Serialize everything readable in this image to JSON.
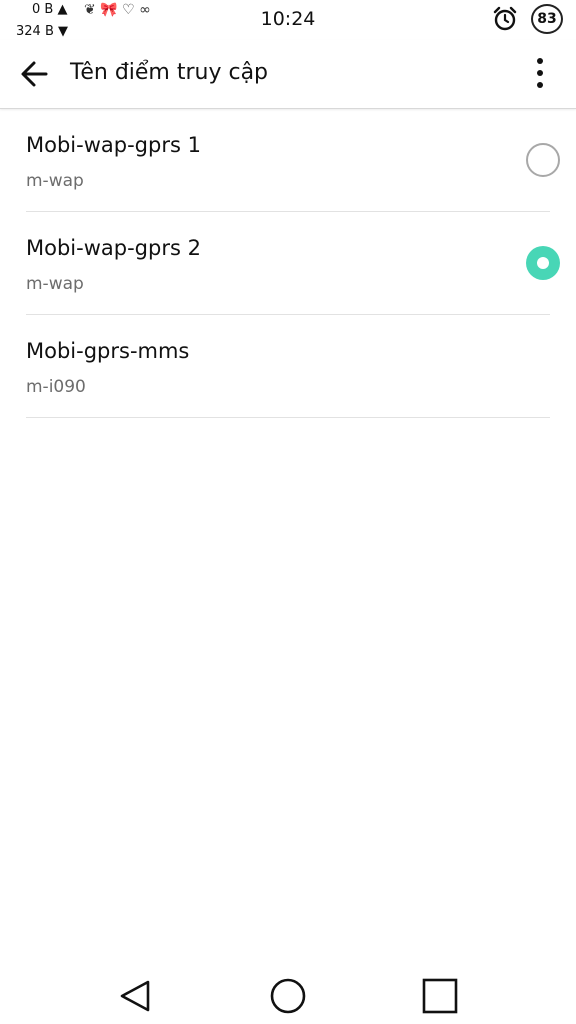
{
  "status_bar": {
    "net_up": "0 B ▲",
    "net_down": "324 B ▼",
    "decoration": "❦ 🎀 ♡ ∞",
    "time": "10:24",
    "battery": "83",
    "alarm_icon": "alarm-clock-icon"
  },
  "app_bar": {
    "title": "Tên điểm truy cập",
    "back_icon": "arrow-left-icon",
    "overflow_icon": "more-vert-icon"
  },
  "apn_list": [
    {
      "name": "Mobi-wap-gprs 1",
      "apn": "m-wap",
      "selected": false,
      "has_radio": true
    },
    {
      "name": "Mobi-wap-gprs 2",
      "apn": "m-wap",
      "selected": true,
      "has_radio": true
    },
    {
      "name": "Mobi-gprs-mms",
      "apn": "m-i090",
      "selected": false,
      "has_radio": false
    }
  ],
  "colors": {
    "accent": "#48d6b6",
    "divider": "#e2e2e2",
    "secondary_text": "#6d6d6d"
  },
  "nav_bar": {
    "back_icon": "triangle-back-icon",
    "home_icon": "circle-home-icon",
    "recents_icon": "square-recents-icon"
  }
}
